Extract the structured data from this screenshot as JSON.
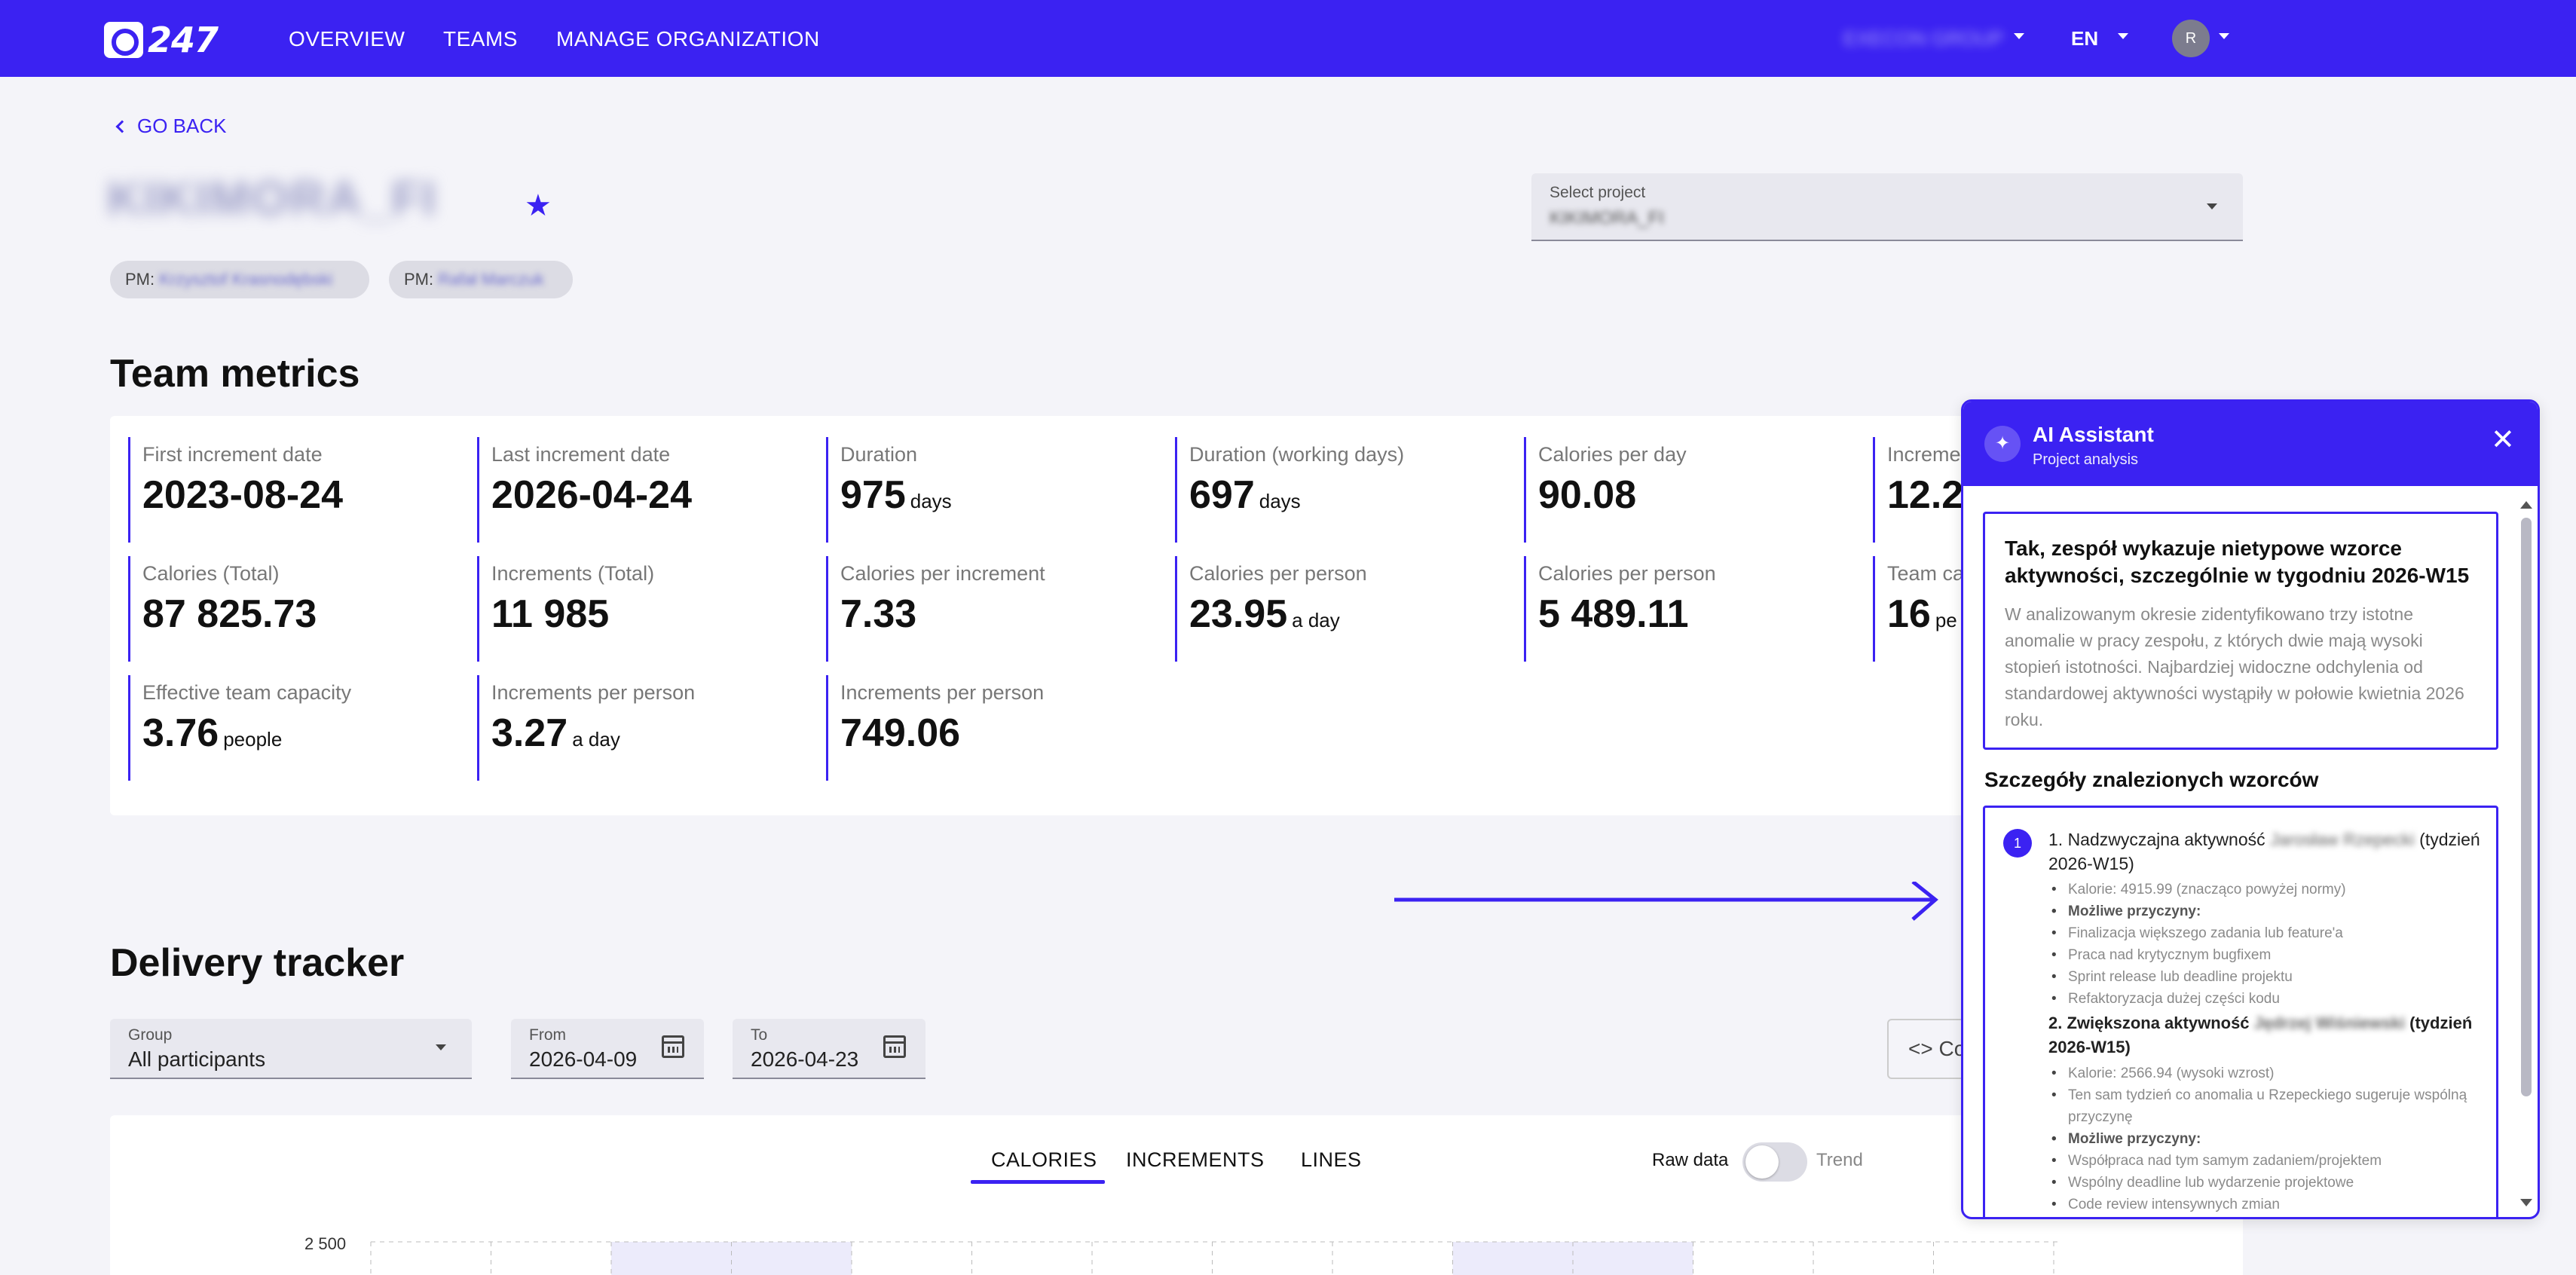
{
  "nav": {
    "logo_text": "247",
    "items": [
      "OVERVIEW",
      "TEAMS",
      "MANAGE ORGANIZATION"
    ],
    "org_name": "EXECON GROUP",
    "language": "EN",
    "avatar_initial": "R"
  },
  "header": {
    "go_back": "GO BACK",
    "project_title": "KIKIMORA_FI",
    "favorite_icon": "star-icon",
    "pm_chips": [
      {
        "prefix": "PM:",
        "name": "Krzysztof Krasnodębski"
      },
      {
        "prefix": "PM:",
        "name": "Rafał Marczuk"
      }
    ],
    "select_project": {
      "label": "Select project",
      "value": "KIKIMORA_FI"
    }
  },
  "team_metrics": {
    "title": "Team metrics",
    "items": [
      {
        "label": "First increment date",
        "value": "2023-08-24",
        "unit": ""
      },
      {
        "label": "Last increment date",
        "value": "2026-04-24",
        "unit": ""
      },
      {
        "label": "Duration",
        "value": "975",
        "unit": "days"
      },
      {
        "label": "Duration (working days)",
        "value": "697",
        "unit": "days"
      },
      {
        "label": "Calories per day",
        "value": "90.08",
        "unit": ""
      },
      {
        "label": "Increme",
        "value": "12.2",
        "unit": ""
      },
      {
        "label": "Calories (Total)",
        "value": "87 825.73",
        "unit": ""
      },
      {
        "label": "Increments (Total)",
        "value": "11 985",
        "unit": ""
      },
      {
        "label": "Calories per increment",
        "value": "7.33",
        "unit": ""
      },
      {
        "label": "Calories per person",
        "value": "23.95",
        "unit": "a day"
      },
      {
        "label": "Calories per person",
        "value": "5 489.11",
        "unit": ""
      },
      {
        "label": "Team ca",
        "value": "16",
        "unit": "pe"
      },
      {
        "label": "Effective team capacity",
        "value": "3.76",
        "unit": "people"
      },
      {
        "label": "Increments per person",
        "value": "3.27",
        "unit": "a day"
      },
      {
        "label": "Increments per person",
        "value": "749.06",
        "unit": ""
      }
    ]
  },
  "delivery": {
    "title": "Delivery tracker",
    "group": {
      "label": "Group",
      "value": "All participants"
    },
    "from": {
      "label": "From",
      "value": "2026-04-09"
    },
    "to": {
      "label": "To",
      "value": "2026-04-23"
    },
    "code_button": "Co",
    "tabs": [
      "CALORIES",
      "INCREMENTS",
      "LINES"
    ],
    "active_tab": "CALORIES",
    "toggle_left": "Raw data",
    "toggle_right": "Trend",
    "y_tick": "2 500"
  },
  "ai_panel": {
    "title": "AI Assistant",
    "subtitle": "Project analysis",
    "summary_heading": "Tak, zespół wykazuje nietypowe wzorce aktywności, szczególnie w tygodniu 2026-W15",
    "summary_text": "W analizowanym okresie zidentyfikowano trzy istotne anomalie w pracy zespołu, z których dwie mają wysoki stopień istotności. Najbardziej widoczne odchylenia od standardowej aktywności wystąpiły w połowie kwietnia 2026 roku.",
    "details_title": "Szczegóły znalezionych wzorców",
    "finding1": {
      "number": "1",
      "title_prefix": "1. Nadzwyczajna aktywność",
      "person": "Jarosław Rzepecki",
      "week": "(tydzień 2026-W15)",
      "items": [
        {
          "text": "Kalorie: 4915.99 (znacząco powyżej normy)",
          "bold": false
        },
        {
          "text": "Możliwe przyczyny:",
          "bold": true
        },
        {
          "text": "Finalizacja większego zadania lub feature'a",
          "bold": false
        },
        {
          "text": "Praca nad krytycznym bugfixem",
          "bold": false
        },
        {
          "text": "Sprint release lub deadline projektu",
          "bold": false
        },
        {
          "text": "Refaktoryzacja dużej części kodu",
          "bold": false
        }
      ]
    },
    "finding2": {
      "title_prefix": "2. Zwiększona aktywność",
      "person": "Jędrzej Wiśniewski",
      "week": "(tydzień 2026-W15)",
      "items": [
        {
          "text": "Kalorie: 2566.94 (wysoki wzrost)",
          "bold": false
        },
        {
          "text": "Ten sam tydzień co anomalia u Rzepeckiego sugeruje wspólną przyczynę",
          "bold": false
        },
        {
          "text": "Możliwe przyczyny:",
          "bold": true
        },
        {
          "text": "Współpraca nad tym samym zadaniem/projektem",
          "bold": false
        },
        {
          "text": "Wspólny deadline lub wydarzenie projektowe",
          "bold": false
        },
        {
          "text": "Code review intensywnych zmian",
          "bold": false
        }
      ]
    }
  },
  "colors": {
    "brand": "#3b22f2",
    "background": "#f4f4f9",
    "card": "#ffffff"
  }
}
